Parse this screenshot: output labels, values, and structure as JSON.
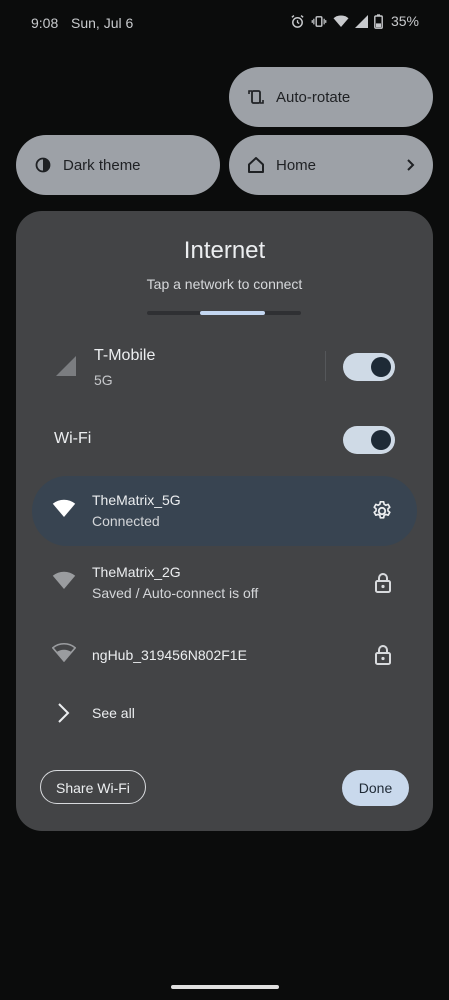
{
  "status_bar": {
    "time": "9:08",
    "date": "Sun, Jul 6",
    "battery": "35%",
    "icons": [
      "alarm-icon",
      "vibrate-icon",
      "wifi-icon",
      "cell-signal-icon",
      "battery-icon"
    ]
  },
  "tiles": {
    "autorotate": {
      "label": "Auto-rotate",
      "icon": "autorotate-icon"
    },
    "dark_theme": {
      "label": "Dark theme",
      "icon": "dark-theme-icon"
    },
    "home": {
      "label": "Home",
      "icon": "home-icon"
    }
  },
  "dialog": {
    "title": "Internet",
    "subtitle": "Tap a network to connect",
    "cellular": {
      "name": "T-Mobile",
      "type": "5G",
      "enabled": true
    },
    "wifi": {
      "label": "Wi-Fi",
      "enabled": true
    },
    "networks": [
      {
        "name": "TheMatrix_5G",
        "status": "Connected",
        "action_icon": "settings-icon",
        "active": true
      },
      {
        "name": "TheMatrix_2G",
        "status": "Saved / Auto-connect is off",
        "action_icon": "lock-icon",
        "active": false
      },
      {
        "name": "ngHub_319456N802F1E",
        "status": "",
        "action_icon": "lock-icon",
        "active": false
      }
    ],
    "see_all": "See all",
    "share_wifi": "Share Wi-Fi",
    "done": "Done"
  },
  "colors": {
    "background": "#0b0c0c",
    "dialog": "#434446",
    "tile": "#9da1a7",
    "active_network": "#384451",
    "accent": "#c9d9ec"
  }
}
